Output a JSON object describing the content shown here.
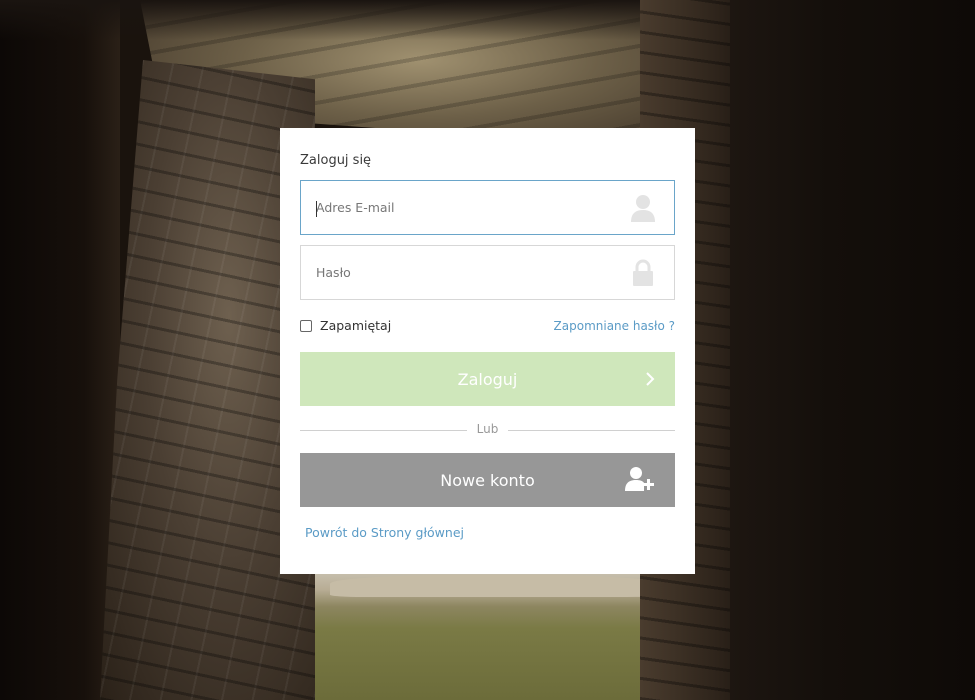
{
  "login": {
    "title": "Zaloguj się",
    "email_placeholder": "Adres E-mail",
    "email_value": "",
    "password_placeholder": "Hasło",
    "password_value": "",
    "remember_label": "Zapamiętaj",
    "remember_checked": false,
    "forgot_label": "Zapomniane hasło ?",
    "submit_label": "Zaloguj",
    "divider_label": "Lub",
    "new_account_label": "Nowe konto",
    "back_label": "Powrót do Strony głównej"
  },
  "icons": {
    "email": "user-icon",
    "password": "lock-icon",
    "submit": "chevron-right-icon",
    "new_account": "add-user-icon"
  },
  "colors": {
    "link": "#5b9bc6",
    "login_button": "#cfe7bb",
    "new_account_button": "#979797",
    "focus_border": "#6aa5c9"
  }
}
